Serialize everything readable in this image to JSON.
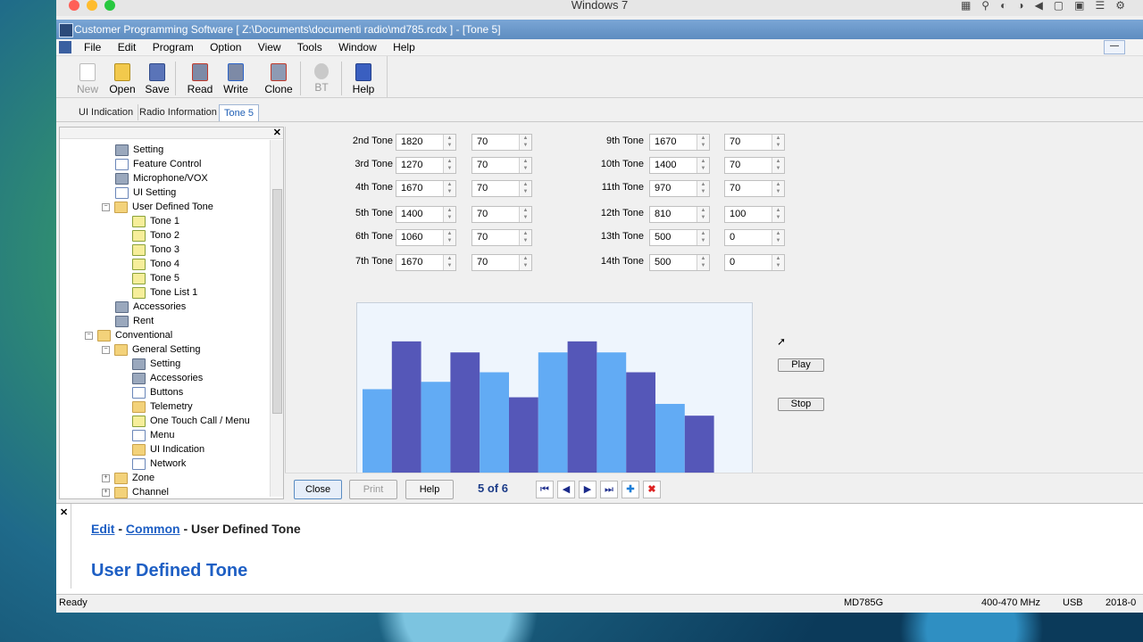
{
  "os": {
    "title": "Windows 7"
  },
  "window": {
    "title": "Customer Programming Software [ Z:\\Documents\\documenti radio\\md785.rcdx ] - [Tone 5]"
  },
  "menu": [
    "File",
    "Edit",
    "Program",
    "Option",
    "View",
    "Tools",
    "Window",
    "Help"
  ],
  "toolbar": {
    "new": "New",
    "open": "Open",
    "save": "Save",
    "read": "Read",
    "write": "Write",
    "clone": "Clone",
    "bt": "BT",
    "help": "Help"
  },
  "tabs": [
    "UI Indication",
    "Radio Information",
    "Tone 5"
  ],
  "tree": [
    {
      "label": "Setting"
    },
    {
      "label": "Feature Control"
    },
    {
      "label": "Microphone/VOX"
    },
    {
      "label": "UI Setting"
    },
    {
      "label": "User Defined Tone"
    },
    {
      "label": "Tone 1"
    },
    {
      "label": "Tono 2"
    },
    {
      "label": "Tono 3"
    },
    {
      "label": "Tono 4"
    },
    {
      "label": "Tone 5"
    },
    {
      "label": "Tone List 1"
    },
    {
      "label": "Accessories"
    },
    {
      "label": "Rent"
    },
    {
      "label": "Conventional"
    },
    {
      "label": "General Setting"
    },
    {
      "label": "Setting"
    },
    {
      "label": "Accessories"
    },
    {
      "label": "Buttons"
    },
    {
      "label": "Telemetry"
    },
    {
      "label": "One Touch Call / Menu"
    },
    {
      "label": "Menu"
    },
    {
      "label": "UI Indication"
    },
    {
      "label": "Network"
    },
    {
      "label": "Zone"
    },
    {
      "label": "Channel"
    }
  ],
  "tones_left": [
    {
      "label": "2nd Tone",
      "freq": "1820",
      "dur": "70"
    },
    {
      "label": "3rd Tone",
      "freq": "1270",
      "dur": "70"
    },
    {
      "label": "4th Tone",
      "freq": "1670",
      "dur": "70"
    },
    {
      "label": "5th Tone",
      "freq": "1400",
      "dur": "70"
    },
    {
      "label": "6th Tone",
      "freq": "1060",
      "dur": "70"
    },
    {
      "label": "7th Tone",
      "freq": "1670",
      "dur": "70"
    }
  ],
  "tones_right": [
    {
      "label": "9th Tone",
      "freq": "1670",
      "dur": "70"
    },
    {
      "label": "10th Tone",
      "freq": "1400",
      "dur": "70"
    },
    {
      "label": "11th Tone",
      "freq": "970",
      "dur": "70"
    },
    {
      "label": "12th Tone",
      "freq": "810",
      "dur": "100"
    },
    {
      "label": "13th Tone",
      "freq": "500",
      "dur": "0"
    },
    {
      "label": "14th Tone",
      "freq": "500",
      "dur": "0"
    }
  ],
  "chart_data": {
    "type": "bar",
    "values": [
      1170,
      1820,
      1270,
      1670,
      1400,
      1060,
      1670,
      1820,
      1670,
      1400,
      970,
      810
    ],
    "colors": [
      "#62abf4",
      "#5557b8"
    ],
    "ylim": [
      0,
      2000
    ]
  },
  "buttons": {
    "play": "Play",
    "stop": "Stop"
  },
  "nav": {
    "close": "Close",
    "print": "Print",
    "help": "Help",
    "counter": "5 of 6"
  },
  "help_pane": {
    "crumb_edit": "Edit",
    "crumb_sep1": " - ",
    "crumb_common": "Common",
    "crumb_rest": " - User Defined Tone",
    "title": "User Defined Tone"
  },
  "status": {
    "left": "Ready",
    "model": "MD785G",
    "band": "400-470 MHz",
    "conn": "USB",
    "date": "2018-0"
  }
}
